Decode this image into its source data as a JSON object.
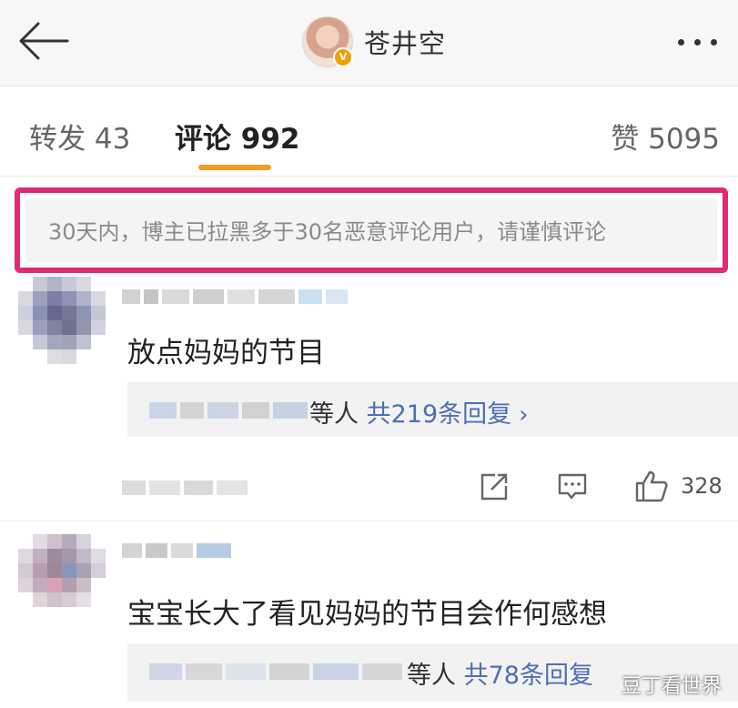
{
  "header": {
    "title": "苍井空",
    "verified_badge": "V"
  },
  "tabs": {
    "repost": "转发 43",
    "comments": "评论 992",
    "likes": "赞 5095"
  },
  "notice": {
    "text": "30天内，博主已拉黑多于30名恶意评论用户，请谨慎评论"
  },
  "comments": [
    {
      "text": "放点妈妈的节目",
      "reply_others": "等人",
      "reply_count": "共219条回复",
      "likes": "328"
    },
    {
      "text": "宝宝长大了看见妈妈的节目会作何感想",
      "reply_others": "等人",
      "reply_count": "共78条回复"
    }
  ],
  "icons": {
    "back": "arrow-left-icon",
    "more": "more-dots-icon",
    "share": "share-icon",
    "comment": "comment-icon",
    "like": "thumbs-up-icon"
  },
  "colors": {
    "tab_underline": "#f79a22",
    "notice_border": "#e02a73",
    "link_blue": "#4c6fb5"
  },
  "watermark": "豆丁看世界"
}
